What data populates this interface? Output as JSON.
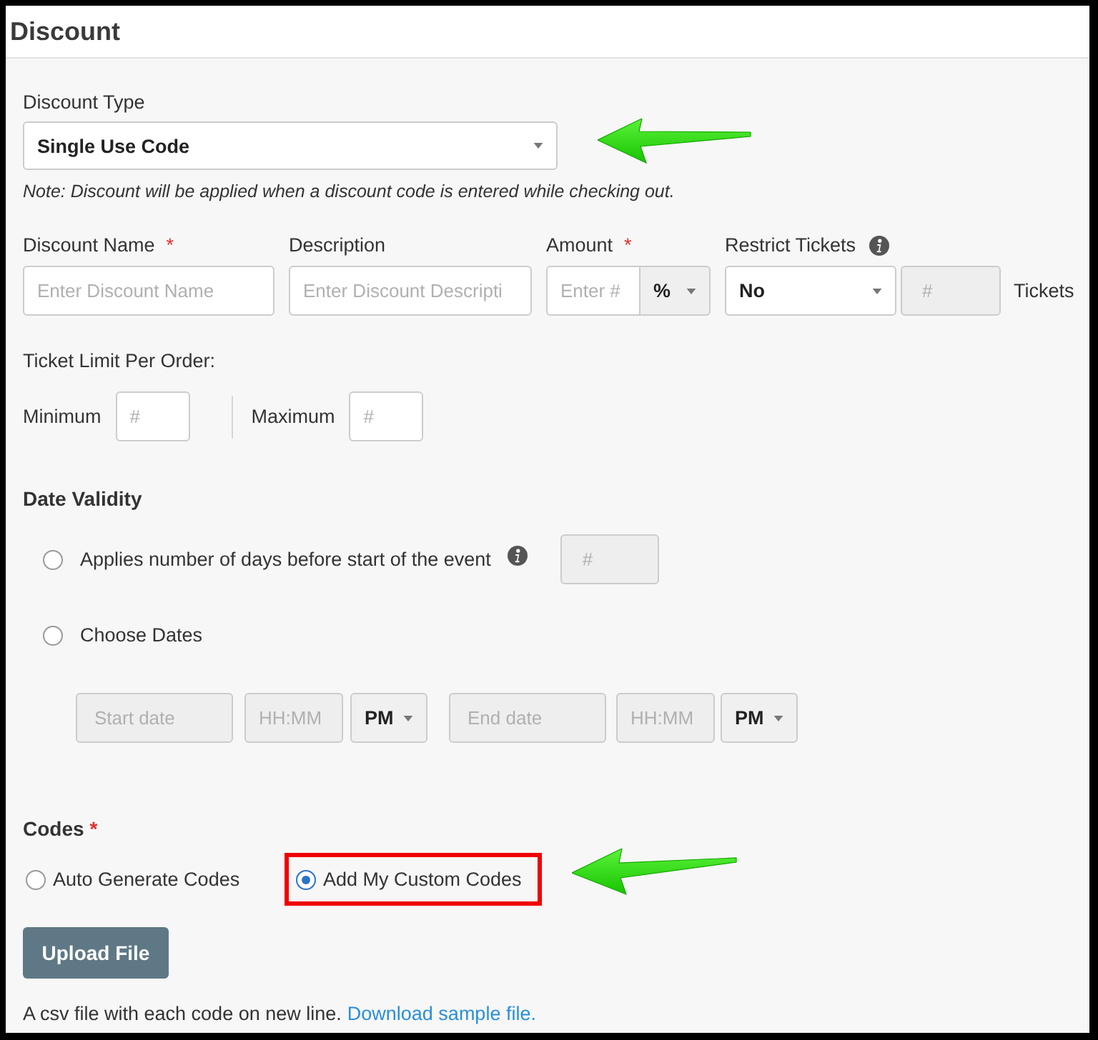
{
  "title": "Discount",
  "discount_type": {
    "label": "Discount Type",
    "value": "Single Use Code",
    "annotated": true
  },
  "note": "Note: Discount will be applied when a discount code is entered while checking out.",
  "fields": {
    "discount_name": {
      "label": "Discount Name",
      "required_mark": "*",
      "placeholder": "Enter Discount Name"
    },
    "description": {
      "label": "Description",
      "placeholder": "Enter Discount Descripti"
    },
    "amount": {
      "label": "Amount",
      "required_mark": "*",
      "placeholder": "Enter #",
      "unit": "%"
    },
    "restrict_tickets": {
      "label": "Restrict Tickets",
      "value": "No",
      "count_placeholder": "#",
      "count_disabled": true,
      "suffix": "Tickets"
    }
  },
  "ticket_limit": {
    "label": "Ticket Limit Per Order:",
    "minimum": {
      "label": "Minimum",
      "placeholder": "#"
    },
    "maximum": {
      "label": "Maximum",
      "placeholder": "#"
    }
  },
  "date_validity": {
    "title": "Date Validity",
    "options": [
      {
        "kind": "days",
        "label": "Applies number of days before start of the event",
        "selected": false,
        "placeholder": "#",
        "disabled": true
      },
      {
        "kind": "dates",
        "label": "Choose Dates",
        "selected": false
      }
    ],
    "date_range": {
      "disabled": true,
      "start": {
        "date_placeholder": "Start date",
        "time_placeholder": "HH:MM",
        "period": "PM"
      },
      "end": {
        "date_placeholder": "End date",
        "time_placeholder": "HH:MM",
        "period": "PM"
      }
    }
  },
  "codes": {
    "title": "Codes",
    "required_mark": "*",
    "options": [
      {
        "label": "Auto Generate Codes",
        "selected": false,
        "highlighted": false
      },
      {
        "label": "Add My Custom Codes",
        "selected": true,
        "highlighted": true
      }
    ],
    "upload_button": "Upload File",
    "help": "A csv file with each code on new line.",
    "help_link": "Download sample file."
  }
}
